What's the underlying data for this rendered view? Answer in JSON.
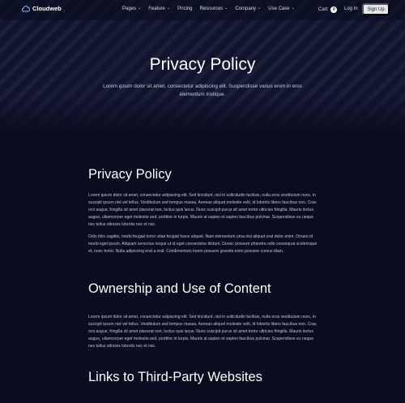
{
  "brand": {
    "name": "Cloudweb"
  },
  "nav": {
    "items": [
      {
        "label": "Pages",
        "has_dropdown": true
      },
      {
        "label": "Feature",
        "has_dropdown": true
      },
      {
        "label": "Pricing",
        "has_dropdown": false
      },
      {
        "label": "Resources",
        "has_dropdown": true
      },
      {
        "label": "Company",
        "has_dropdown": true
      },
      {
        "label": "Use Case",
        "has_dropdown": true
      }
    ],
    "cart_label": "Cart",
    "cart_count": "0",
    "login_label": "Log In",
    "signup_label": "Sign Up"
  },
  "hero": {
    "title": "Privacy Policy",
    "subtitle": "Lorem ipsum dolor sit amet, consectetur adipiscing elit. Suspendisse varius enim in eros elementum tristique."
  },
  "sections": [
    {
      "heading": "Privacy Policy",
      "paragraphs": [
        "Lorem ipsum dolor sit amet, consectetur adipiscing elit. Sed tincidunt, nisl in sollicitudin facilisis, nulla eros vestibulum nunc, in suscipit ipsum nisl vel tellus. Vestibulum sed tempus massa. Aenean aliquet molestie velit, id lobortis libero faucibus non. Cras orci augue, fringilla sit amet placerat non, luctus quis lacus. Nunc suscipit purus sit amet tortor ultricies fringilla. Mauris lectus augue, ullamcorper eget molestie sed, porttitor in turpis. Mauris at sapien et sapien faucibus pulvinar. Suspendisse eu neque nec tellus ultricies lobortis nec et nisi.",
        "Odio felis sagittis, morbi feugiat tortor vitae feugiat fusce aliquet. Nam elementum urna nisi aliquet erat dolor enim. Ornare id morbi eget ipsum. Aliquam senectus neque ut id eget consectetur dictum. Donec posuere pharetra odio consequat scelerisque et, nunc tortor. Nulla adipiscing erat a erat. Condimentum lorem posuere gravida enim posuere cursus diam."
      ]
    },
    {
      "heading": "Ownership and Use of Content",
      "paragraphs": [
        "Lorem ipsum dolor sit amet, consectetur adipiscing elit. Sed tincidunt, nisl in sollicitudin facilisis, nulla eros vestibulum nunc, in suscipit ipsum nisl vel tellus. Vestibulum sed tempus massa. Aenean aliquet molestie velit, id lobortis libero faucibus non. Cras orci augue, fringilla sit amet placerat non, luctus quis lacus. Nunc suscipit purus sit amet tortor ultricies fringilla. Mauris lectus augue, ullamcorper eget molestie sed, porttitor in turpis. Mauris at sapien et sapien faucibus pulvinar. Suspendisse eu neque nec tellus ultricies lobortis nec et nisi."
      ]
    },
    {
      "heading": "Links to Third-Party Websites",
      "paragraphs": []
    }
  ],
  "colors": {
    "background": "#0a0c1f",
    "hero_background": "#11142e",
    "body_text": "#c3c6d6",
    "signup_button": "#e5e6ea"
  }
}
